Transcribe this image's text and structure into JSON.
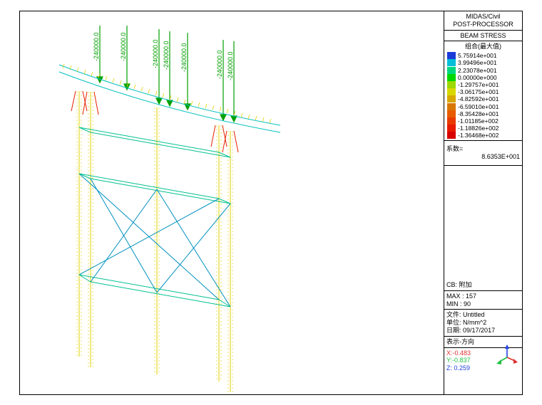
{
  "header": {
    "app_line1": "MIDAS/Civil",
    "app_line2": "POST-PROCESSOR",
    "mode": "BEAM STRESS"
  },
  "legend": {
    "title": "组合(最大值)",
    "items": [
      {
        "color": "#1a3ad8",
        "value": "5.75914e+001"
      },
      {
        "color": "#00bdd8",
        "value": "3.99496e+001"
      },
      {
        "color": "#00d880",
        "value": "2.23078e+001"
      },
      {
        "color": "#00d800",
        "value": "0.00000e+000"
      },
      {
        "color": "#9dd800",
        "value": "-1.29757e+001"
      },
      {
        "color": "#d8d800",
        "value": "-3.06175e+001"
      },
      {
        "color": "#d8a800",
        "value": "-4.82592e+001"
      },
      {
        "color": "#d87800",
        "value": "-6.59010e+001"
      },
      {
        "color": "#e85a00",
        "value": "-8.35428e+001"
      },
      {
        "color": "#e83a00",
        "value": "-1.01185e+002"
      },
      {
        "color": "#e81a00",
        "value": "-1.18826e+002"
      },
      {
        "color": "#d80000",
        "value": "-1.36468e+002"
      }
    ],
    "scale_label": "系数=",
    "scale_value": "8.6353E+001"
  },
  "info": {
    "cb_label": "CB:",
    "cb_value": "附加",
    "max_label": "MAX :",
    "max_value": "157",
    "min_label": "MIN :",
    "min_value": "90",
    "file_label": "文件:",
    "file_value": "Untitled",
    "unit_label": "单位:",
    "unit_value": "N/mm^2",
    "date_label": "日期:",
    "date_value": "09/17/2017",
    "view_label": "表示-方向"
  },
  "coords": {
    "x_label": "X:-0.483",
    "y_label": "Y:-0.837",
    "z_label": "Z: 0.259"
  },
  "loads": {
    "value": "-240000.0"
  }
}
